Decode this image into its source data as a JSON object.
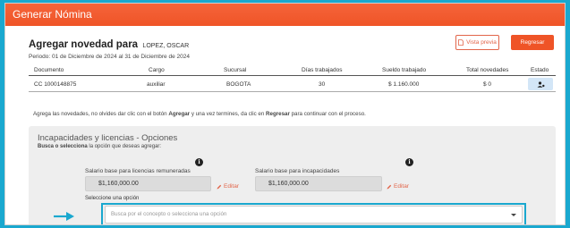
{
  "header": {
    "title": "Generar Nómina"
  },
  "novedad": {
    "heading": "Agregar novedad para",
    "employee_name": "LOPEZ, OSCAR",
    "period": "Periodo: 01 de Diciembre de 2024 al 31 de Diciembre de 2024"
  },
  "buttons": {
    "preview_label": "Vista previa",
    "back_label": "Regresar"
  },
  "table": {
    "headers": [
      "Documento",
      "Cargo",
      "Sucursal",
      "Días trabajados",
      "Sueldo trabajado",
      "Total novedades",
      "Estado"
    ],
    "rows": [
      {
        "documento": "CC 1000148875",
        "cargo": "auxiliar",
        "sucursal": "BOGOTA",
        "dias": "30",
        "sueldo": "$ 1.160.000",
        "novedades": "$ 0",
        "estado_icon": "user-settings-icon"
      }
    ]
  },
  "help": {
    "p1": "Agrega las novedades, no olvides dar clic con el botón ",
    "b1": "Agregar",
    "p2": " y una vez termines, da clic en ",
    "b2": "Regresar",
    "p3": " para continuar con el proceso."
  },
  "panel": {
    "title": "Incapacidades y licencias - Opciones",
    "subtitle_bold": "Busca o selecciona",
    "subtitle_rest": " la opción que deseas agregar:",
    "field1": {
      "label": "Salario base para licencias remuneradas",
      "value": "$1,160,000.00",
      "edit": "Editar"
    },
    "field2": {
      "label": "Salario base para incapacidades",
      "value": "$1,160,000.00",
      "edit": "Editar"
    },
    "select": {
      "label": "Seleccione una opción",
      "placeholder": "Busca por el concepto o selecciona una opción"
    }
  },
  "colors": {
    "header": "#ef5427",
    "accent": "#e2654a",
    "highlight": "#1aa8cf",
    "panel": "#eeeeee"
  }
}
